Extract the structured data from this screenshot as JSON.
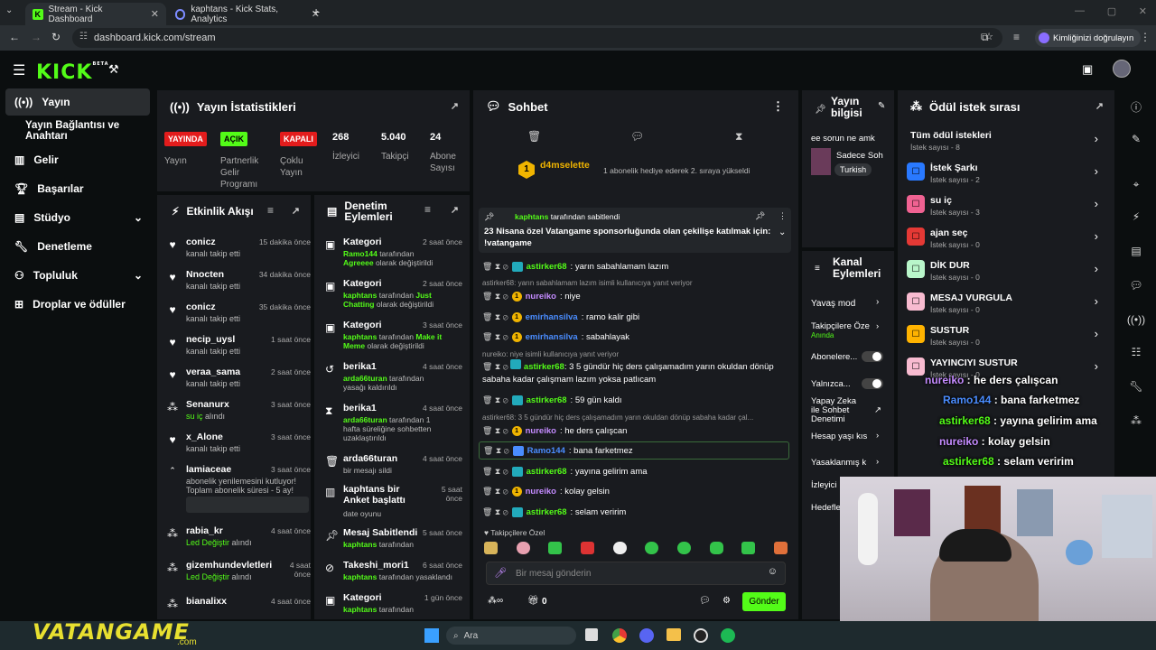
{
  "browser": {
    "tabs": [
      {
        "title": "Stream - Kick Dashboard",
        "active": true
      },
      {
        "title": "kaphtans - Kick Stats, Analytics",
        "active": false
      }
    ],
    "new_tab": "+",
    "url": "dashboard.kick.com/stream",
    "profile_label": "Kimliğinizi doğrulayın"
  },
  "app": {
    "logo": "KICK",
    "logo_sup": "BETA"
  },
  "sidebar": {
    "items": [
      {
        "label": "Yayın",
        "icon": "broadcast-icon"
      },
      {
        "label": "Yayın Bağlantısı ve Anahtarı",
        "icon": ""
      },
      {
        "label": "Gelir",
        "icon": "chart-icon"
      },
      {
        "label": "Başarılar",
        "icon": "trophy-icon"
      },
      {
        "label": "Stüdyo",
        "icon": "grid-icon"
      },
      {
        "label": "Denetleme",
        "icon": "wrench-icon"
      },
      {
        "label": "Topluluk",
        "icon": "people-icon"
      },
      {
        "label": "Droplar ve ödüller",
        "icon": "gift-icon"
      }
    ]
  },
  "stats": {
    "title": "Yayın İstatistikleri",
    "items": [
      {
        "badge": "YAYINDA",
        "label": "Yayın"
      },
      {
        "badge": "AÇIK",
        "label": "Partnerlik Gelir Programı"
      },
      {
        "badge": "KAPALI",
        "label": "Çoklu Yayın"
      },
      {
        "value": "268",
        "label": "İzleyici"
      },
      {
        "value": "5.040",
        "label": "Takipçi"
      },
      {
        "value": "24",
        "label": "Abone Sayısı"
      }
    ]
  },
  "activity": {
    "title": "Etkinlik Akışı",
    "events": [
      {
        "name": "conicz",
        "sub": "kanalı takip etti",
        "time": "15 dakika önce"
      },
      {
        "name": "Nnocten",
        "sub": "kanalı takip etti",
        "time": "34 dakika önce"
      },
      {
        "name": "conicz",
        "sub": "kanalı takip etti",
        "time": "35 dakika önce"
      },
      {
        "name": "necip_uysl",
        "sub": "kanalı takip etti",
        "time": "1 saat önce"
      },
      {
        "name": "veraa_sama",
        "sub": "kanalı takip etti",
        "time": "2 saat önce"
      },
      {
        "name": "Senanurx",
        "sub_highlight": "su iç",
        "sub": "alındı",
        "time": "3 saat önce"
      },
      {
        "name": "x_Alone",
        "sub": "kanalı takip etti",
        "time": "3 saat önce"
      },
      {
        "name": "lamiaceae",
        "sub": "abonelik yenilemesini kutluyor! Toplam abonelik süresi - 5 ay!",
        "time": "3 saat önce"
      },
      {
        "name": "rabia_kr",
        "sub_highlight": "Led Değiştir",
        "sub": "alındı",
        "time": "4 saat önce"
      },
      {
        "name": "gizemhundevletleri",
        "sub_highlight": "Led Değiştir",
        "sub": "alındı",
        "time": "4 saat önce"
      },
      {
        "name": "bianalixx",
        "sub": "",
        "time": "4 saat önce"
      }
    ]
  },
  "moderation": {
    "title": "Denetim Eylemleri",
    "items": [
      {
        "name": "Kategori",
        "time": "2 saat önce",
        "by": "Ramo144",
        "mid": "tarafından",
        "hl": "Agreeee",
        "rest": "olarak değiştirildi"
      },
      {
        "name": "Kategori",
        "time": "2 saat önce",
        "by": "kaphtans",
        "mid": "tarafından",
        "hl": "Just Chatting",
        "rest": "olarak değiştirildi"
      },
      {
        "name": "Kategori",
        "time": "3 saat önce",
        "by": "kaphtans",
        "mid": "tarafından",
        "hl": "Make it Meme",
        "rest": "olarak değiştirildi"
      },
      {
        "name": "berika1",
        "time": "4 saat önce",
        "by": "arda66turan",
        "mid": "tarafından yasağı kaldırıldı",
        "hl": "",
        "rest": ""
      },
      {
        "name": "berika1",
        "time": "4 saat önce",
        "by": "arda66turan",
        "mid": "tarafından 1 hafta süreliğine sohbetten uzaklaştırıldı",
        "hl": "",
        "rest": ""
      },
      {
        "name": "arda66turan",
        "time": "4 saat önce",
        "by": "",
        "mid": "bir mesajı sildi",
        "hl": "",
        "rest": ""
      },
      {
        "name": "kaphtans bir Anket başlattı",
        "time": "5 saat önce",
        "by": "",
        "mid": "date oyunu",
        "hl": "",
        "rest": ""
      },
      {
        "name": "Mesaj Sabitlendi",
        "time": "5 saat önce",
        "by": "kaphtans",
        "mid": "tarafından",
        "hl": "",
        "rest": ""
      },
      {
        "name": "Takeshi_mori1",
        "time": "6 saat önce",
        "by": "kaphtans",
        "mid": "tarafından yasaklandı",
        "hl": "",
        "rest": ""
      },
      {
        "name": "Kategori",
        "time": "1 gün önce",
        "by": "kaphtans",
        "mid": "tarafından",
        "hl": "",
        "rest": ""
      }
    ]
  },
  "chat": {
    "title": "Sohbet",
    "gift_user": "d4mselette",
    "gift_text": "1 abonelik hediye ederek 2. sıraya yükseldi",
    "pinned_by": "kaphtans",
    "pinned_suffix": "tarafından sabitlendi",
    "pinned_text": "23 Nisana özel Vatangame sponsorluğunda olan çekilişe katılmak için: !vatangame",
    "messages": [
      {
        "user": "astirker68",
        "color": "green",
        "text": "yarın sabahlamam lazım"
      },
      {
        "reply": "astirker68: yarın sabahlamam lazım isimli kullanıcıya yanıt veriyor"
      },
      {
        "user": "nureiko",
        "color": "purple",
        "text": "niye"
      },
      {
        "user": "emirhansilva",
        "color": "blue",
        "text": "ramo kalir gibi"
      },
      {
        "user": "emirhansilva",
        "color": "blue",
        "text": "sabahlayak"
      },
      {
        "reply": "nureiko: niye isimli kullanıcıya yanıt veriyor"
      },
      {
        "user": "astirker68",
        "color": "green",
        "text": "3 5 gündür hiç ders çalışamadım yarın okuldan dönüp sabaha kadar çalışmam lazım yoksa patlıcam"
      },
      {
        "user": "astirker68",
        "color": "green",
        "text": "59 gün kaldı"
      },
      {
        "reply": "astirker68: 3 5 gündür hiç ders çalışamadım yarın okuldan dönüp sabaha kadar çal..."
      },
      {
        "user": "nureiko",
        "color": "purple",
        "text": "he ders çalışcan"
      },
      {
        "user": "Ramo144",
        "color": "blue",
        "text": "bana farketmez"
      },
      {
        "user": "astirker68",
        "color": "green",
        "text": "yayına gelirim ama"
      },
      {
        "user": "nureiko",
        "color": "purple",
        "text": "kolay gelsin"
      },
      {
        "user": "astirker68",
        "color": "green",
        "text": "selam veririm"
      }
    ],
    "emote_label": "Takipçilere Özel",
    "input_placeholder": "Bir mesaj gönderin",
    "points": "0",
    "send_label": "Gönder"
  },
  "stream_info": {
    "title": "Yayın bilgisi",
    "line1": "ee sorun ne amk",
    "line2": "Sadece Soh",
    "tag": "Turkish"
  },
  "channel_actions": {
    "title": "Kanal Eylemleri",
    "items": [
      {
        "label": "Yavaş mod"
      },
      {
        "label": "Takipçilere Öze",
        "sub": "Anında"
      },
      {
        "label": "Abonelere..."
      },
      {
        "label": "Yalnızca..."
      },
      {
        "label": "Yapay Zeka ile Sohbet Denetimi"
      },
      {
        "label": "Hesap yaşı kıs"
      },
      {
        "label": "Yasaklanmış k"
      },
      {
        "label": "İzleyici"
      },
      {
        "label": "Hedefle"
      }
    ]
  },
  "rewards": {
    "title": "Ödül istek sırası",
    "all_label": "Tüm ödül istekleri",
    "all_sub": "İstek sayısı - 8",
    "items": [
      {
        "name": "İstek Şarkı",
        "sub": "İstek sayısı - 2",
        "color": "#2979ff"
      },
      {
        "name": "su iç",
        "sub": "İstek sayısı - 3",
        "color": "#f06292"
      },
      {
        "name": "ajan seç",
        "sub": "İstek sayısı - 0",
        "color": "#e53935"
      },
      {
        "name": "DİK DUR",
        "sub": "İstek sayısı - 0",
        "color": "#b9f6ca"
      },
      {
        "name": "MESAJ VURGULA",
        "sub": "İstek sayısı - 0",
        "color": "#f8bbd0"
      },
      {
        "name": "SUSTUR",
        "sub": "İstek sayısı - 0",
        "color": "#ffb300"
      },
      {
        "name": "YAYINCIYI SUSTUR",
        "sub": "İstek sayısı - 0",
        "color": "#f8bbd0"
      }
    ],
    "overlay": [
      {
        "user": "nureiko",
        "text": "he ders çalışcan"
      },
      {
        "user": "Ramo144",
        "text": "bana farketmez"
      },
      {
        "user": "astirker68",
        "text": "yayına gelirim ama"
      },
      {
        "user": "nureiko",
        "text": "kolay gelsin"
      },
      {
        "user": "astirker68",
        "text": "selam veririm"
      }
    ]
  },
  "taskbar": {
    "search": "Ara",
    "brand": "VATANGAME",
    "brand_sub": ".com"
  }
}
